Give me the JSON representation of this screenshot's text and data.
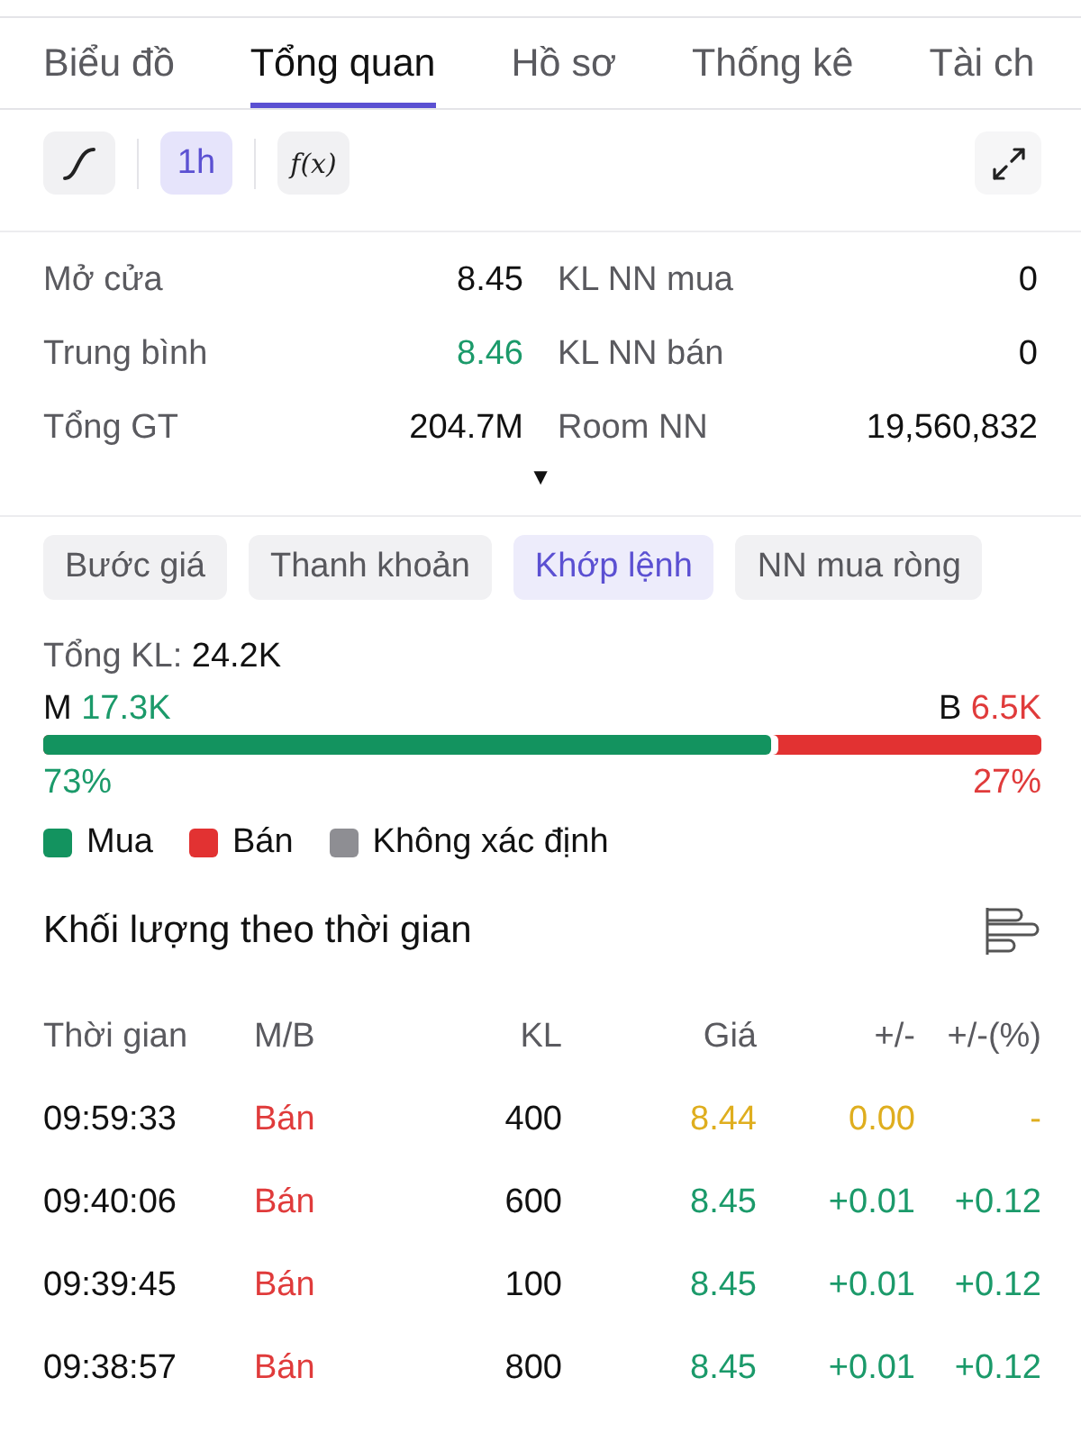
{
  "tabs": [
    {
      "label": "Biểu đồ",
      "selected": false
    },
    {
      "label": "Tổng quan",
      "selected": true
    },
    {
      "label": "Hồ sơ",
      "selected": false
    },
    {
      "label": "Thống kê",
      "selected": false
    },
    {
      "label": "Tài ch",
      "selected": false
    }
  ],
  "toolbar": {
    "tools": [
      {
        "kind": "curve",
        "selected": false
      },
      {
        "kind": "interval",
        "label": "1h",
        "selected": true
      },
      {
        "kind": "function",
        "label": "f(x)",
        "selected": false
      }
    ]
  },
  "stats": {
    "items": [
      {
        "label": "Mở cửa",
        "value": "8.45",
        "rising": false
      },
      {
        "label": "KL NN mua",
        "value": "0",
        "rising": false
      },
      {
        "label": "Trung bình",
        "value": "8.46",
        "rising": true
      },
      {
        "label": "KL NN bán",
        "value": "0",
        "rising": false
      },
      {
        "label": "Tổng GT",
        "value": "204.7M",
        "rising": false
      },
      {
        "label": "Room NN",
        "value": "19,560,832",
        "rising": false
      }
    ],
    "toggle": "▼"
  },
  "segments": [
    {
      "label": "Bước giá",
      "selected": false
    },
    {
      "label": "Thanh khoản",
      "selected": false
    },
    {
      "label": "Khớp lệnh",
      "selected": true
    },
    {
      "label": "NN mua ròng",
      "selected": false
    }
  ],
  "volume": {
    "total_label": "Tổng KL:",
    "total": "24.2K",
    "buy_label": "M",
    "buy": "17.3K",
    "sell_label": "B",
    "sell": "6.5K",
    "level": 0.73,
    "buy_pct": "73%",
    "sell_pct": "27%"
  },
  "legend": [
    {
      "label": "Mua",
      "color": "#13935f"
    },
    {
      "label": "Bán",
      "color": "#e23232"
    },
    {
      "label": "Không xác định",
      "color": "#8e8e93"
    }
  ],
  "trades": {
    "title": "Khối lượng theo thời gian",
    "columns": [
      "Thời gian",
      "M/B",
      "KL",
      "Giá",
      "+/-",
      "+/-(%)"
    ],
    "rows": [
      {
        "time": "09:59:33",
        "sell": true,
        "side_label": "Bán",
        "volume": "400",
        "price": "8.44",
        "change": "0.00",
        "change_pct": "-",
        "color": "#dfae1f"
      },
      {
        "time": "09:40:06",
        "sell": true,
        "side_label": "Bán",
        "volume": "600",
        "price": "8.45",
        "change": "+0.01",
        "change_pct": "+0.12",
        "color": "#1b9a6a"
      },
      {
        "time": "09:39:45",
        "sell": true,
        "side_label": "Bán",
        "volume": "100",
        "price": "8.45",
        "change": "+0.01",
        "change_pct": "+0.12",
        "color": "#1b9a6a"
      },
      {
        "time": "09:38:57",
        "sell": true,
        "side_label": "Bán",
        "volume": "800",
        "price": "8.45",
        "change": "+0.01",
        "change_pct": "+0.12",
        "color": "#1b9a6a"
      }
    ]
  }
}
